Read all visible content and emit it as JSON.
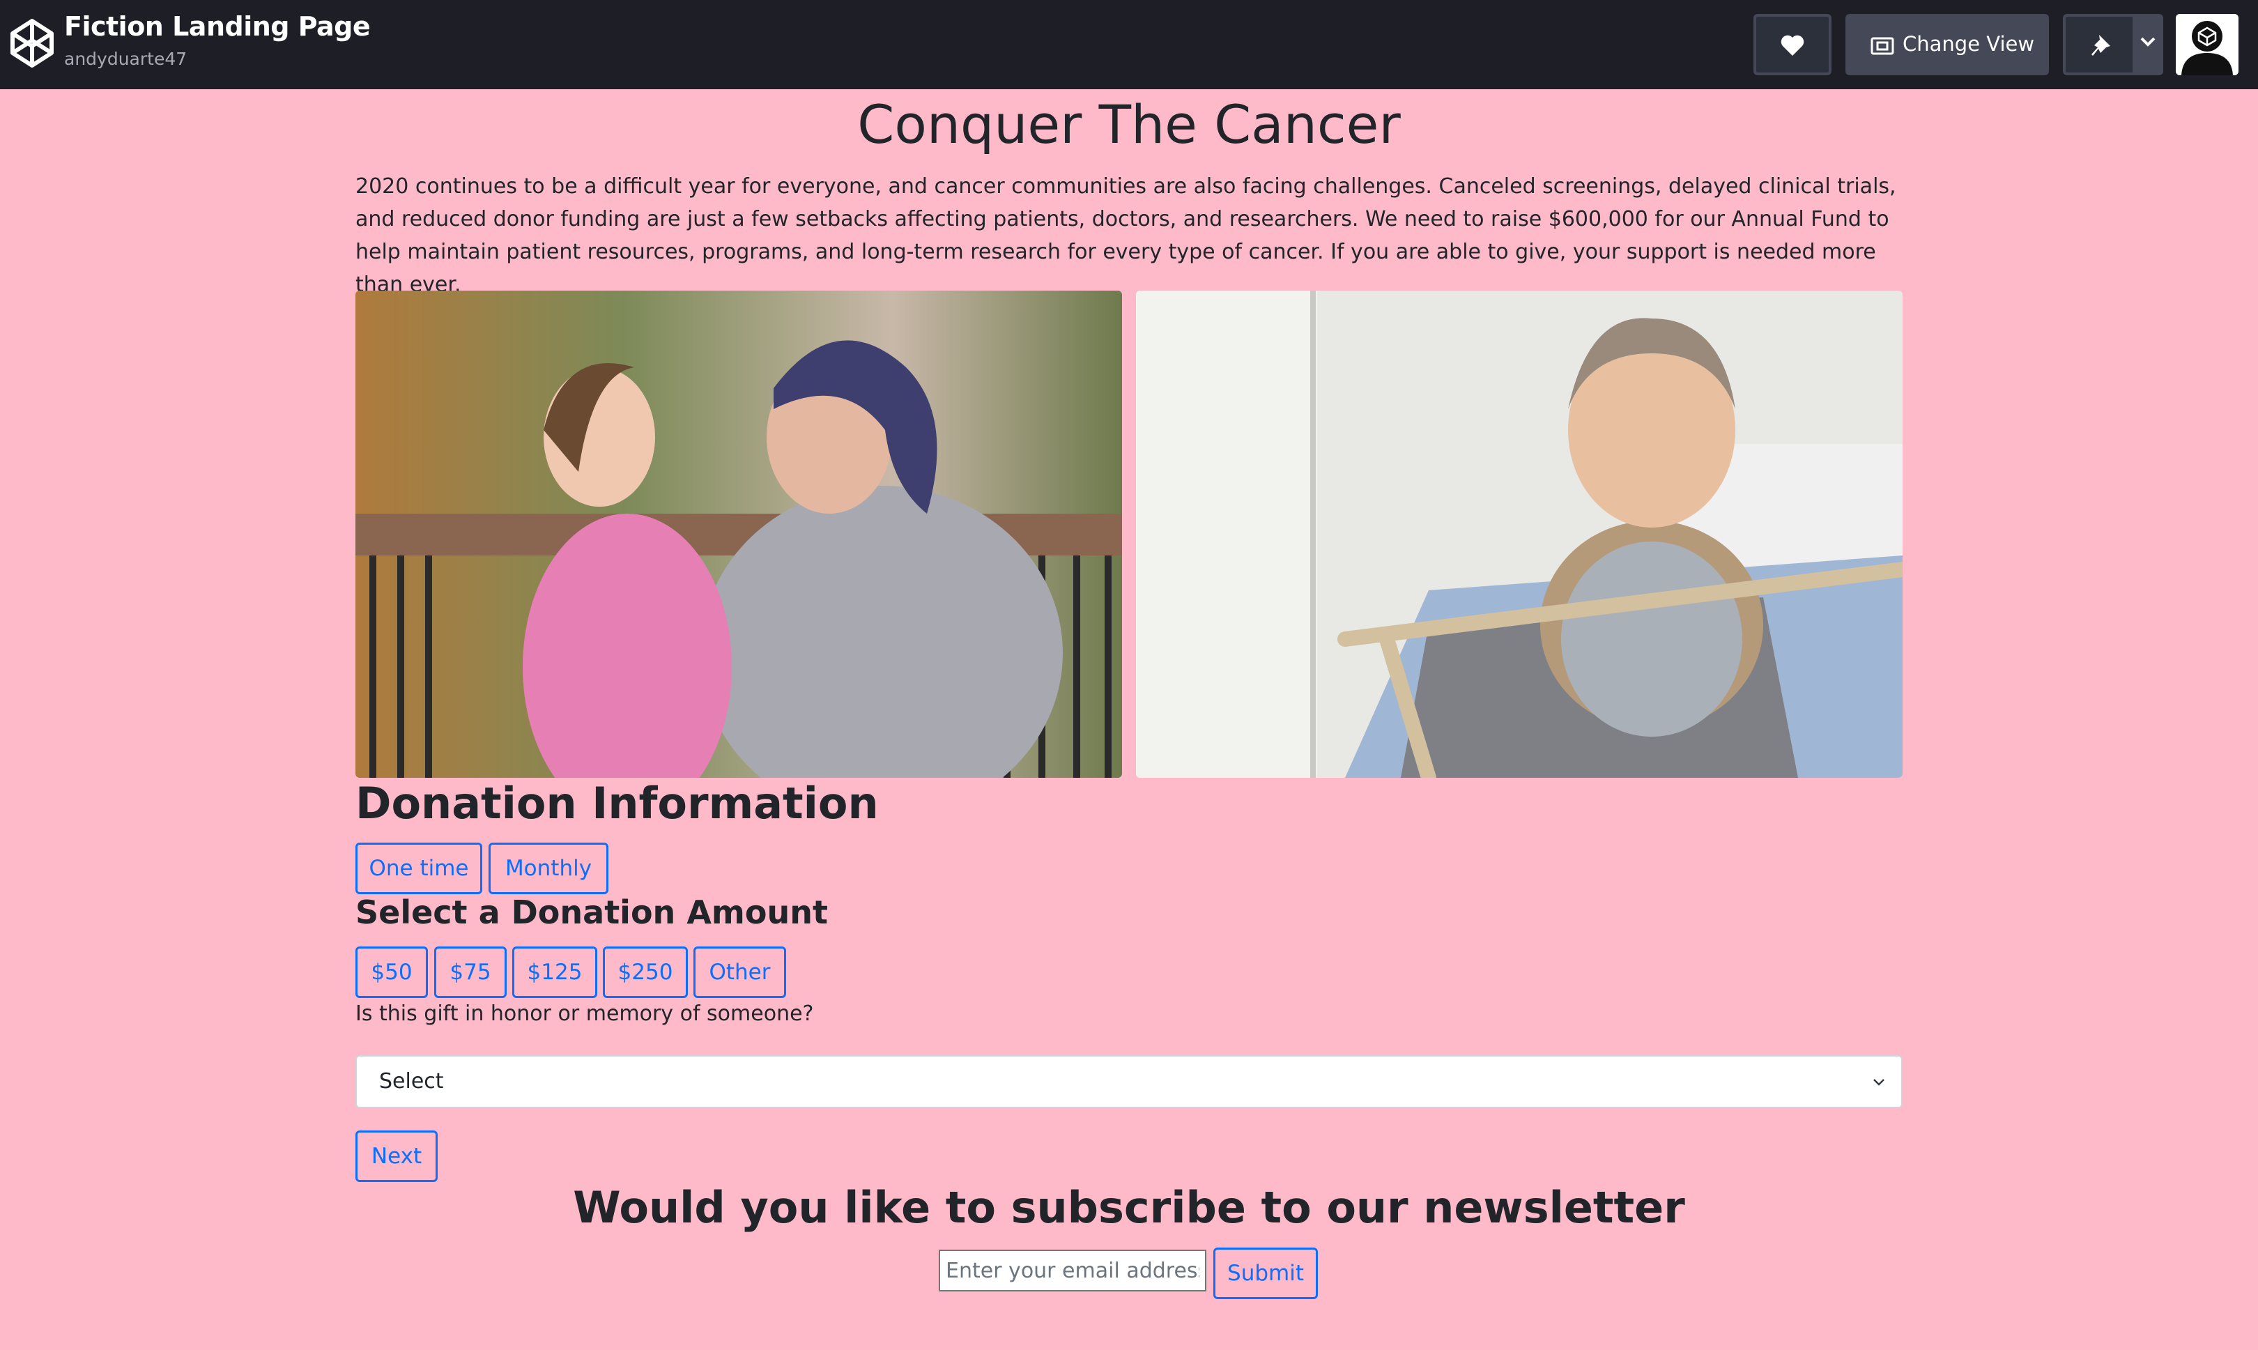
{
  "header": {
    "pen_title": "Fiction Landing Page",
    "author": "andyduarte47",
    "change_view_label": "Change View",
    "icons": [
      "codepen-logo-icon",
      "heart-icon",
      "change-view-icon",
      "pin-icon",
      "chevron-down-icon",
      "user-avatar"
    ]
  },
  "main": {
    "title": "Conquer The Cancer",
    "intro": "2020 continues to be a difficult year for everyone, and cancer communities are also facing challenges. Canceled screenings, delayed clinical trials, and reduced donor funding are just a few setbacks affecting patients, doctors, and researchers. We need to raise $600,000 for our Annual Fund to help maintain patient resources, programs, and long-term research for every type of cancer. If you are able to give, your support is needed more than ever."
  },
  "donation": {
    "heading": "Donation Information",
    "frequency": [
      "One time",
      "Monthly"
    ],
    "amount_heading": "Select a Donation Amount",
    "amounts": [
      "$50",
      "$75",
      "$125",
      "$250",
      "Other"
    ],
    "honor_question": "Is this gift in honor or memory of someone?",
    "honor_select_value": "Select",
    "next_label": "Next"
  },
  "newsletter": {
    "heading": "Would you like to subscribe to our newsletter",
    "email_placeholder": "Enter your email address",
    "submit_label": "Submit"
  },
  "colors": {
    "page_background": "#ffbac9",
    "topbar_background": "#1e1f26",
    "accent": "#0d6efd"
  }
}
